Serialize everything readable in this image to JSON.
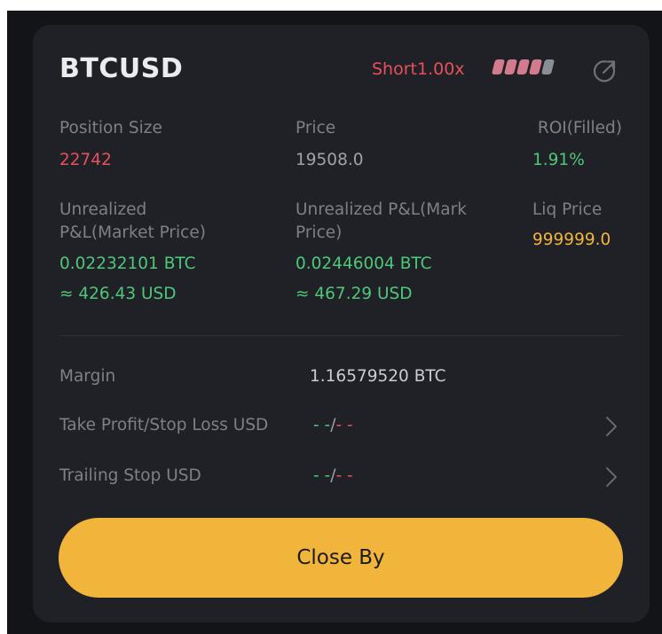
{
  "position": {
    "symbol": "BTCUSD",
    "side_leverage": "Short1.00x",
    "leverage_indicator": {
      "filled": 4,
      "total": 5,
      "filled_color": "#d47a8e",
      "empty_color": "#8a8d94"
    },
    "share_icon": "share-arrow-icon"
  },
  "stats": {
    "position_size": {
      "label": "Position Size",
      "value": "22742",
      "color": "#e8505b"
    },
    "price": {
      "label": "Price",
      "value": "19508.0"
    },
    "roi": {
      "label": "ROI(Filled)",
      "value": "1.91%",
      "color": "#4fc77a"
    },
    "unrealized_market": {
      "label_line1": "Unrealized",
      "label_line2": "P&L(Market Price)",
      "btc": "0.02232101 BTC",
      "usd": "≈ 426.43 USD"
    },
    "unrealized_mark": {
      "label_line1": "Unrealized P&L(Mark",
      "label_line2": "Price)",
      "btc": "0.02446004 BTC",
      "usd": "≈ 467.29 USD"
    },
    "liq_price": {
      "label": "Liq Price",
      "value": "999999.0",
      "color": "#f2b53c"
    }
  },
  "details": {
    "margin": {
      "label": "Margin",
      "value": "1.16579520 BTC"
    },
    "tp_sl": {
      "label": "Take Profit/Stop Loss USD",
      "tp": "- -",
      "sep": "/",
      "sl": "- -"
    },
    "trailing": {
      "label": "Trailing Stop USD",
      "tp": "- -",
      "sep": "/",
      "sl": "- -"
    }
  },
  "actions": {
    "close_by": "Close By",
    "button_color": "#f2b53c"
  }
}
